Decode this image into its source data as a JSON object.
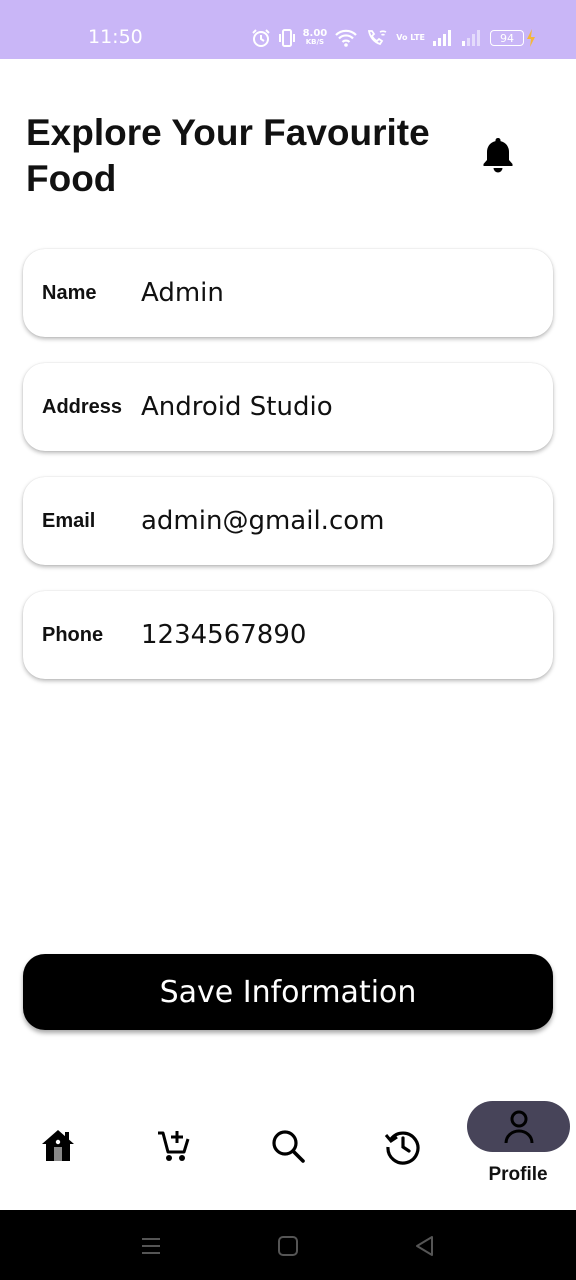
{
  "status_bar": {
    "time": "11:50",
    "net_speed": "8.00",
    "net_unit": "KB/S",
    "volte": "Vo LTE",
    "battery": "94",
    "background_color": "#c9b6f7"
  },
  "header": {
    "title": "Explore Your Favourite Food",
    "notification_icon": "bell-icon"
  },
  "profile_fields": [
    {
      "label": "Name",
      "value": "Admin"
    },
    {
      "label": "Address",
      "value": "Android Studio"
    },
    {
      "label": "Email",
      "value": "admin@gmail.com"
    },
    {
      "label": "Phone",
      "value": "1234567890"
    }
  ],
  "actions": {
    "save_label": "Save Information"
  },
  "bottom_nav": {
    "items": [
      {
        "icon": "home-icon"
      },
      {
        "icon": "cart-add-icon"
      },
      {
        "icon": "search-icon"
      },
      {
        "icon": "history-icon"
      },
      {
        "icon": "profile-icon",
        "label": "Profile",
        "selected": true
      }
    ],
    "selected_color": "#474459"
  },
  "system_nav": {
    "icons": [
      "menu-icon",
      "home-square-icon",
      "back-triangle-icon"
    ]
  }
}
